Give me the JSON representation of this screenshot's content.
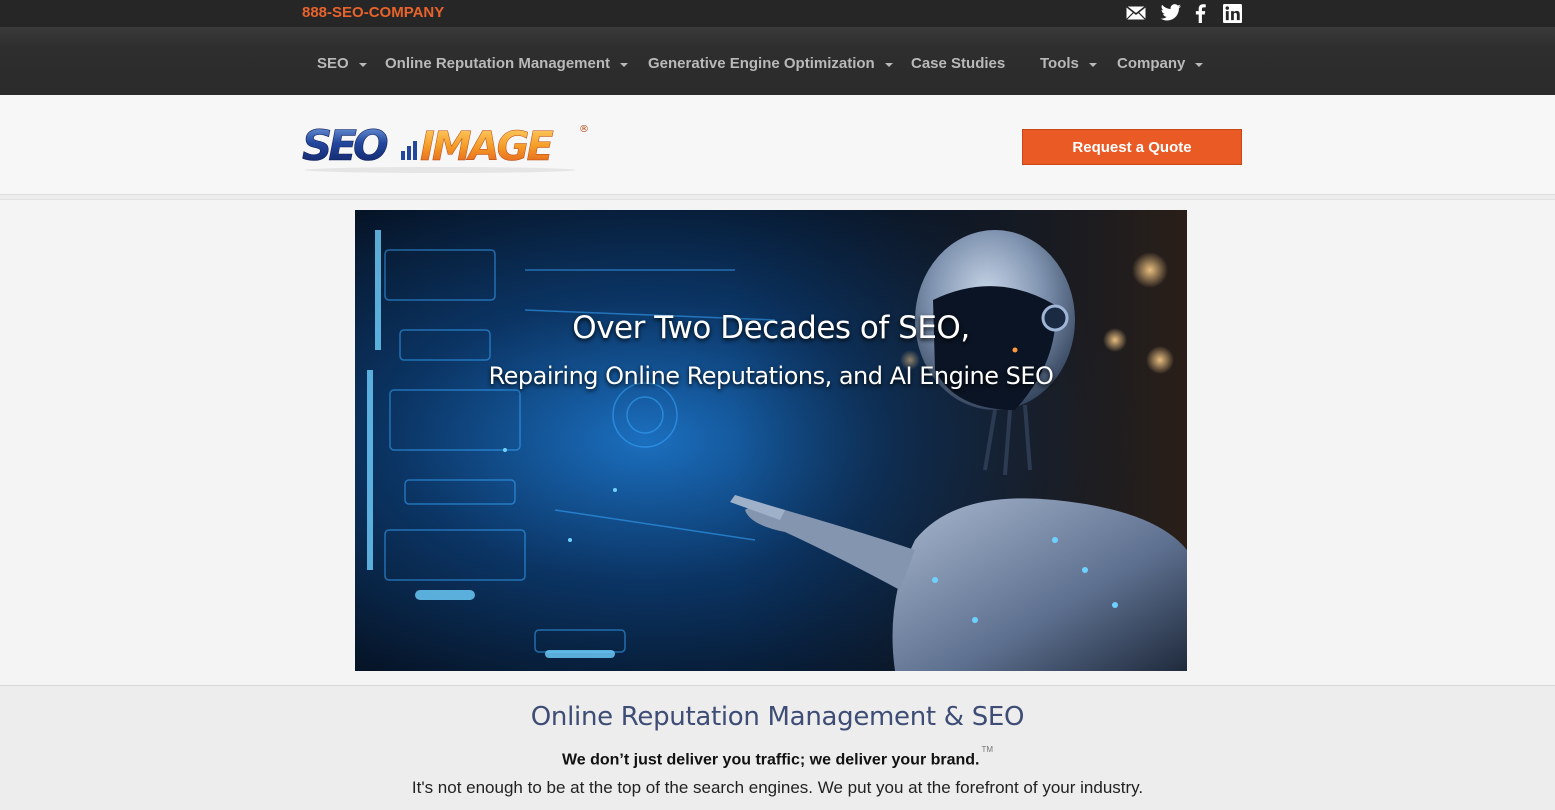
{
  "topbar": {
    "phone": "888-SEO-COMPANY",
    "social_icons": [
      "mail-icon",
      "twitter-icon",
      "facebook-icon",
      "linkedin-icon"
    ]
  },
  "nav": {
    "items": [
      {
        "label": "SEO",
        "dropdown": true
      },
      {
        "label": "Online Reputation Management",
        "dropdown": true
      },
      {
        "label": "Generative Engine Optimization",
        "dropdown": true
      },
      {
        "label": "Case Studies",
        "dropdown": false
      },
      {
        "label": "Tools",
        "dropdown": true
      },
      {
        "label": "Company",
        "dropdown": true
      }
    ]
  },
  "header": {
    "logo": {
      "part1": "SEO",
      "part2": "IMAGE",
      "mark": "®"
    },
    "quote_button": "Request a Quote"
  },
  "hero": {
    "line1": "Over Two Decades of SEO,",
    "line2": "Repairing Online Reputations, and AI Engine SEO"
  },
  "content": {
    "title": "Online Reputation Management & SEO",
    "tagline": "We don’t just deliver you traffic; we deliver your brand.",
    "trademark": "TM",
    "subline": "It's not enough to be at the top of the search engines. We put you at the forefront of your industry."
  },
  "colors": {
    "accent": "#e8632c",
    "button": "#ea5a25",
    "topbar": "#262626",
    "navbar": "#2e2e2e",
    "title_text": "#3e4d75"
  }
}
